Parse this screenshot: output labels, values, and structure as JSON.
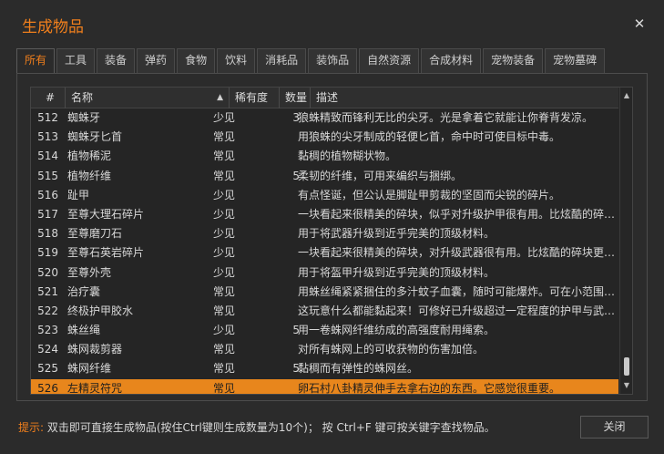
{
  "window": {
    "title": "生成物品",
    "close_glyph": "✕"
  },
  "tabs": [
    "所有",
    "工具",
    "装备",
    "弹药",
    "食物",
    "饮料",
    "消耗品",
    "装饰品",
    "自然资源",
    "合成材料",
    "宠物装备",
    "宠物墓碑"
  ],
  "active_tab": 0,
  "table": {
    "headers": {
      "num": "#",
      "name": "名称",
      "rarity": "稀有度",
      "qty": "数量",
      "desc": "描述"
    },
    "sort_indicator": "▲",
    "rows": [
      {
        "num": "512",
        "name": "蜘蛛牙",
        "rarity": "少见",
        "qty": "3",
        "desc": "狼蛛精致而锋利无比的尖牙。光是拿着它就能让你脊背发凉。"
      },
      {
        "num": "513",
        "name": "蜘蛛牙匕首",
        "rarity": "常见",
        "qty": "",
        "desc": "用狼蛛的尖牙制成的轻便匕首，命中时可使目标中毒。"
      },
      {
        "num": "514",
        "name": "植物稀泥",
        "rarity": "常见",
        "qty": "",
        "desc": "黏稠的植物糊状物。"
      },
      {
        "num": "515",
        "name": "植物纤维",
        "rarity": "常见",
        "qty": "5",
        "desc": "柔韧的纤维，可用来编织与捆绑。"
      },
      {
        "num": "516",
        "name": "趾甲",
        "rarity": "少见",
        "qty": "",
        "desc": "有点怪诞，但公认是脚趾甲剪裁的坚固而尖锐的碎片。"
      },
      {
        "num": "517",
        "name": "至尊大理石碎片",
        "rarity": "少见",
        "qty": "",
        "desc": "一块看起来很精美的碎块，似乎对升级护甲很有用。比炫酷的碎…"
      },
      {
        "num": "518",
        "name": "至尊磨刀石",
        "rarity": "少见",
        "qty": "",
        "desc": "用于将武器升级到近乎完美的顶级材料。"
      },
      {
        "num": "519",
        "name": "至尊石英岩碎片",
        "rarity": "少见",
        "qty": "",
        "desc": "一块看起来很精美的碎块，对升级武器很有用。比炫酷的碎块更…"
      },
      {
        "num": "520",
        "name": "至尊外壳",
        "rarity": "少见",
        "qty": "",
        "desc": "用于将盔甲升级到近乎完美的顶级材料。"
      },
      {
        "num": "521",
        "name": "治疗囊",
        "rarity": "常见",
        "qty": "",
        "desc": "用蛛丝绳紧紧捆住的多汁蚊子血囊，随时可能爆炸。可在小范围…"
      },
      {
        "num": "522",
        "name": "终极护甲胶水",
        "rarity": "常见",
        "qty": "",
        "desc": "这玩意什么都能黏起来！可修好已升级超过一定程度的护甲与武…"
      },
      {
        "num": "523",
        "name": "蛛丝绳",
        "rarity": "少见",
        "qty": "5",
        "desc": "用一卷蛛网纤维纺成的高强度耐用绳索。"
      },
      {
        "num": "524",
        "name": "蛛网裁剪器",
        "rarity": "常见",
        "qty": "",
        "desc": "对所有蛛网上的可收获物的伤害加倍。"
      },
      {
        "num": "525",
        "name": "蛛网纤维",
        "rarity": "常见",
        "qty": "5",
        "desc": "黏稠而有弹性的蛛网丝。"
      },
      {
        "num": "526",
        "name": "左精灵符咒",
        "rarity": "常见",
        "qty": "",
        "desc": "卵石村八卦精灵伸手去拿右边的东西。它感觉很重要。"
      }
    ],
    "selected_index": 14
  },
  "scrollbar": {
    "up_glyph": "▲",
    "down_glyph": "▼"
  },
  "footer": {
    "hint_label": "提示:",
    "hint_text": " 双击即可直接生成物品(按住Ctrl键则生成数量为10个)； 按 Ctrl+F 键可按关键字查找物品。",
    "close_label": "关闭"
  },
  "colors": {
    "accent": "#f07f1c",
    "selected_row": "#e8861c",
    "background": "#2b2b2b"
  }
}
